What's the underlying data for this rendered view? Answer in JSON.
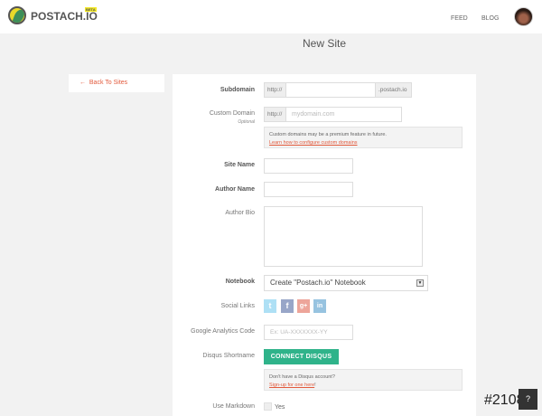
{
  "header": {
    "brand": "POSTACH.IO",
    "badge": "BETA",
    "nav": [
      "FEED",
      "BLOG"
    ]
  },
  "page": {
    "title": "New Site",
    "back": "Back To Sites"
  },
  "form": {
    "subdomain": {
      "label": "Subdomain",
      "prefix": "http://",
      "suffix": ".postach.io",
      "value": ""
    },
    "custom_domain": {
      "label": "Custom Domain",
      "sublabel": "Optional",
      "prefix": "http://",
      "placeholder": "mydomain.com",
      "note": "Custom domains may be a premium feature in future.",
      "link": "Learn how to configure custom domains"
    },
    "site_name": {
      "label": "Site Name"
    },
    "author_name": {
      "label": "Author Name"
    },
    "author_bio": {
      "label": "Author Bio"
    },
    "notebook": {
      "label": "Notebook",
      "value": "Create \"Postach.io\" Notebook"
    },
    "social": {
      "label": "Social Links",
      "icons": [
        "twitter-icon",
        "facebook-icon",
        "google-plus-icon",
        "linkedin-icon"
      ]
    },
    "ga": {
      "label": "Google Analytics Code",
      "placeholder": "Ex: UA-XXXXXXX-YY"
    },
    "disqus": {
      "label": "Disqus Shortname",
      "button": "CONNECT DISQUS",
      "note": "Don't have a Disqus account?",
      "link": "Sign-up for one here",
      "link_suffix": "!"
    },
    "markdown": {
      "label": "Use Markdown",
      "option": "Yes"
    }
  },
  "watermark": "#21089",
  "colors": {
    "accent": "#e25a3c",
    "disqus": "#2fb38a"
  }
}
